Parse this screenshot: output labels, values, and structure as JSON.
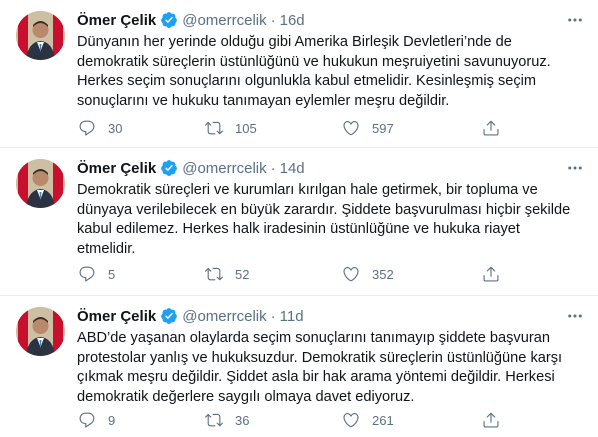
{
  "tweets": [
    {
      "name": "Ömer Çelik",
      "handle": "@omerrcelik",
      "separator": "·",
      "time": "16d",
      "lines": [
        "Dünyanın her yerinde olduğu gibi Amerika Birleşik Devletleri’nde de",
        "demokratik süreçlerin üstünlüğünü ve hukukun meşruiyetini savunuyoruz.",
        "Herkes seçim sonuçlarını olgunlukla kabul etmelidir. Kesinleşmiş seçim",
        "sonuçlarını ve hukuku tanımayan eylemler meşru değildir."
      ],
      "replies": "30",
      "retweets": "105",
      "likes": "597"
    },
    {
      "name": "Ömer Çelik",
      "handle": "@omerrcelik",
      "separator": "·",
      "time": "14d",
      "lines": [
        "Demokratik süreçleri ve kurumları kırılgan hale getirmek, bir topluma ve",
        "dünyaya verilebilecek en büyük zarardır. Şiddete başvurulması hiçbir şekilde",
        "kabul edilemez. Herkes halk iradesinin üstünlüğüne ve hukuka riayet",
        "etmelidir."
      ],
      "replies": "5",
      "retweets": "52",
      "likes": "352"
    },
    {
      "name": "Ömer Çelik",
      "handle": "@omerrcelik",
      "separator": "·",
      "time": "11d",
      "lines": [
        "ABD’de yaşanan olaylarda seçim sonuçlarını tanımayıp şiddete başvuran",
        "protestolar yanlış ve hukuksuzdur. Demokratik süreçlerin üstünlüğüne karşı",
        "çıkmak meşru değildir. Şiddet asla bir hak arama yöntemi değildir. Herkesi",
        "demokratik değerlere saygılı olmaya davet ediyoruz."
      ],
      "replies": "9",
      "retweets": "36",
      "likes": "261"
    }
  ],
  "icons": {
    "verified": "verified-badge-icon",
    "more": "more-options-icon",
    "reply": "reply-icon",
    "retweet": "retweet-icon",
    "like": "like-icon",
    "share": "share-icon"
  },
  "colors": {
    "text": "#0f1419",
    "secondary": "#5b7083",
    "verified": "#1da1f2",
    "divider": "#e6ecf0"
  }
}
